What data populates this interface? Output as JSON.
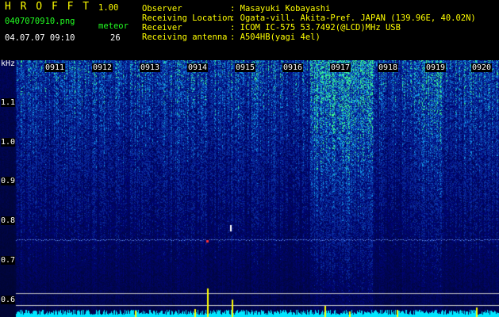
{
  "header": {
    "app_title": "H R O F F T",
    "version": "1.00",
    "filename": "0407070910.png",
    "datetime": "04.07.07 09:10",
    "meteor_label": "meteor",
    "meteor_count": "26",
    "observer_label": "Observer",
    "observer_value": ": Masayuki Kobayashi",
    "location_label": "Receiving Location",
    "location_value": ": Ogata-vill. Akita-Pref. JAPAN (139.96E, 40.02N)",
    "receiver_label": "Receiver",
    "receiver_value": ": ICOM IC-575 53.7492(@LCD)MHz USB",
    "antenna_label": "Receiving antenna",
    "antenna_value": ": A504HB(yagi 4el)"
  },
  "axis": {
    "unit": "kHz",
    "y_ticks": [
      "1.1",
      "1.0",
      "0.9",
      "0.8",
      "0.7",
      "0.6"
    ],
    "time_ticks": [
      "0911",
      "0912",
      "0913",
      "0914",
      "0915",
      "0916",
      "0917",
      "0918",
      "0919",
      "0920"
    ]
  },
  "colors": {
    "background": "#000000",
    "spectrogram_base": "#0a1a6e",
    "spectrogram_hot": "#22ff88",
    "meteor_echo": "#ff3333",
    "level_trace": "#00e5ff",
    "level_peaks": "#ffff00",
    "header_title": "#ffff00",
    "header_meta": "#22ff22",
    "header_info": "#ffffff"
  }
}
